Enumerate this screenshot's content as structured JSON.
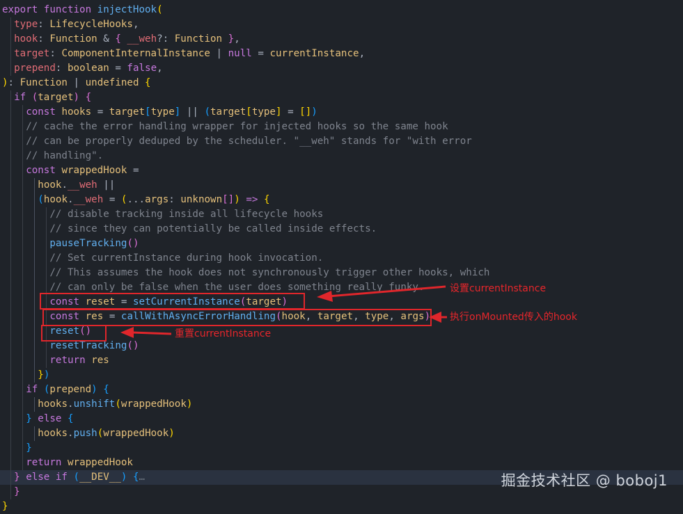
{
  "editor": {
    "language": "typescript",
    "theme": {
      "background": "#1f2329",
      "keyword": "#c678dd",
      "function": "#61afef",
      "type": "#e5c07b",
      "comment": "#7f848e",
      "annotation": "#e0262b"
    },
    "lines": [
      [
        [
          "kw",
          "export "
        ],
        [
          "kw",
          "function "
        ],
        [
          "fn",
          "injectHook"
        ],
        [
          "br1",
          "("
        ]
      ],
      [
        [
          "prop",
          "type"
        ],
        [
          "pl",
          ": "
        ],
        [
          "ty",
          "LifecycleHooks"
        ],
        [
          "pl",
          ","
        ]
      ],
      [
        [
          "prop",
          "hook"
        ],
        [
          "pl",
          ": "
        ],
        [
          "ty",
          "Function "
        ],
        [
          "pl",
          "& "
        ],
        [
          "br2",
          "{ "
        ],
        [
          "prop",
          "__weh"
        ],
        [
          "pl",
          "?: "
        ],
        [
          "ty",
          "Function "
        ],
        [
          "br2",
          "}"
        ],
        [
          "pl",
          ","
        ]
      ],
      [
        [
          "prop",
          "target"
        ],
        [
          "pl",
          ": "
        ],
        [
          "ty",
          "ComponentInternalInstance "
        ],
        [
          "pl",
          "| "
        ],
        [
          "kw",
          "null "
        ],
        [
          "pl",
          "= "
        ],
        [
          "var",
          "currentInstance"
        ],
        [
          "pl",
          ","
        ]
      ],
      [
        [
          "prop",
          "prepend"
        ],
        [
          "pl",
          ": "
        ],
        [
          "ty",
          "boolean "
        ],
        [
          "pl",
          "= "
        ],
        [
          "kw",
          "false"
        ],
        [
          "pl",
          ","
        ]
      ],
      [
        [
          "br1",
          ")"
        ],
        [
          "pl",
          ": "
        ],
        [
          "ty",
          "Function "
        ],
        [
          "pl",
          "| "
        ],
        [
          "ty",
          "undefined "
        ],
        [
          "br1",
          "{"
        ]
      ],
      [
        [
          "kw",
          "if "
        ],
        [
          "br2",
          "("
        ],
        [
          "var",
          "target"
        ],
        [
          "br2",
          ") {"
        ]
      ],
      [
        [
          "kw",
          "const "
        ],
        [
          "var",
          "hooks "
        ],
        [
          "pl",
          "= "
        ],
        [
          "var",
          "target"
        ],
        [
          "br3",
          "["
        ],
        [
          "var",
          "type"
        ],
        [
          "br3",
          "] "
        ],
        [
          "pl",
          "|| "
        ],
        [
          "br3",
          "("
        ],
        [
          "var",
          "target"
        ],
        [
          "br1",
          "["
        ],
        [
          "var",
          "type"
        ],
        [
          "br1",
          "] "
        ],
        [
          "pl",
          "= "
        ],
        [
          "br1",
          "[]"
        ],
        [
          "br3",
          ")"
        ]
      ],
      [
        [
          "cm",
          "// cache the error handling wrapper for injected hooks so the same hook"
        ]
      ],
      [
        [
          "cm",
          "// can be properly deduped by the scheduler. \"__weh\" stands for \"with error"
        ]
      ],
      [
        [
          "cm",
          "// handling\"."
        ]
      ],
      [
        [
          "kw",
          "const "
        ],
        [
          "var",
          "wrappedHook "
        ],
        [
          "pl",
          "="
        ]
      ],
      [
        [
          "var",
          "hook"
        ],
        [
          "pl",
          "."
        ],
        [
          "prop",
          "__weh "
        ],
        [
          "pl",
          "||"
        ]
      ],
      [
        [
          "br3",
          "("
        ],
        [
          "var",
          "hook"
        ],
        [
          "pl",
          "."
        ],
        [
          "prop",
          "__weh "
        ],
        [
          "pl",
          "= "
        ],
        [
          "br1",
          "("
        ],
        [
          "pl",
          "..."
        ],
        [
          "var",
          "args"
        ],
        [
          "pl",
          ": "
        ],
        [
          "ty",
          "unknown"
        ],
        [
          "br2",
          "[]"
        ],
        [
          "br1",
          ") "
        ],
        [
          "kw",
          "=> "
        ],
        [
          "br1",
          "{"
        ]
      ],
      [
        [
          "cm",
          "// disable tracking inside all lifecycle hooks"
        ]
      ],
      [
        [
          "cm",
          "// since they can potentially be called inside effects."
        ]
      ],
      [
        [
          "fn",
          "pauseTracking"
        ],
        [
          "br2",
          "()"
        ]
      ],
      [
        [
          "cm",
          "// Set currentInstance during hook invocation."
        ]
      ],
      [
        [
          "cm",
          "// This assumes the hook does not synchronously trigger other hooks, which"
        ]
      ],
      [
        [
          "cm",
          "// can only be false when the user does something really funky."
        ]
      ],
      [
        [
          "kw",
          "const "
        ],
        [
          "var",
          "reset "
        ],
        [
          "pl",
          "= "
        ],
        [
          "fn",
          "setCurrentInstance"
        ],
        [
          "br2",
          "("
        ],
        [
          "var",
          "target"
        ],
        [
          "br2",
          ")"
        ]
      ],
      [
        [
          "kw",
          "const "
        ],
        [
          "var",
          "res "
        ],
        [
          "pl",
          "= "
        ],
        [
          "fn",
          "callWithAsyncErrorHandling"
        ],
        [
          "br2",
          "("
        ],
        [
          "var",
          "hook"
        ],
        [
          "pl",
          ", "
        ],
        [
          "var",
          "target"
        ],
        [
          "pl",
          ", "
        ],
        [
          "var",
          "type"
        ],
        [
          "pl",
          ", "
        ],
        [
          "var",
          "args"
        ],
        [
          "br2",
          ")"
        ]
      ],
      [
        [
          "fn",
          "reset"
        ],
        [
          "br2",
          "()"
        ]
      ],
      [
        [
          "fn",
          "resetTracking"
        ],
        [
          "br2",
          "()"
        ]
      ],
      [
        [
          "kw",
          "return "
        ],
        [
          "var",
          "res"
        ]
      ],
      [
        [
          "br1",
          "}"
        ],
        [
          "br3",
          ")"
        ]
      ],
      [
        [
          "kw",
          "if "
        ],
        [
          "br3",
          "("
        ],
        [
          "var",
          "prepend"
        ],
        [
          "br3",
          ") {"
        ]
      ],
      [
        [
          "var",
          "hooks"
        ],
        [
          "pl",
          "."
        ],
        [
          "fn",
          "unshift"
        ],
        [
          "br1",
          "("
        ],
        [
          "var",
          "wrappedHook"
        ],
        [
          "br1",
          ")"
        ]
      ],
      [
        [
          "br3",
          "} "
        ],
        [
          "kw",
          "else "
        ],
        [
          "br3",
          "{"
        ]
      ],
      [
        [
          "var",
          "hooks"
        ],
        [
          "pl",
          "."
        ],
        [
          "fn",
          "push"
        ],
        [
          "br1",
          "("
        ],
        [
          "var",
          "wrappedHook"
        ],
        [
          "br1",
          ")"
        ]
      ],
      [
        [
          "br3",
          "}"
        ]
      ],
      [
        [
          "kw",
          "return "
        ],
        [
          "var",
          "wrappedHook"
        ]
      ],
      [
        [
          "br2",
          "} "
        ],
        [
          "kw",
          "else if "
        ],
        [
          "br3",
          "("
        ],
        [
          "var",
          "__DEV__"
        ],
        [
          "br3",
          ") "
        ],
        [
          "br3",
          "{"
        ],
        [
          "fold",
          "…"
        ]
      ],
      [
        [
          "br2",
          "}"
        ]
      ],
      [
        [
          "br1",
          "}"
        ]
      ]
    ]
  },
  "annotations": {
    "set_instance": "设置currentInstance",
    "exec_hook": "执行onMounted传入的hook",
    "reset_instance": "重置currentInstance"
  },
  "watermark": "掘金技术社区 @ boboj1"
}
